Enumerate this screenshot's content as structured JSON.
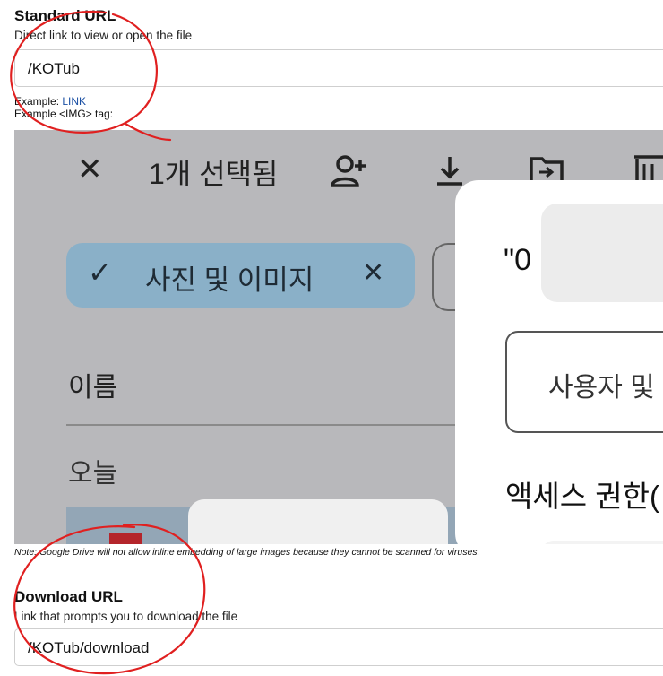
{
  "standard": {
    "title": "Standard URL",
    "description": "Direct link to view or open the file",
    "url_value": "/KOTub",
    "example_label": "Example:",
    "example_link": "LINK",
    "example_img": "Example <IMG> tag:"
  },
  "preview": {
    "toolbar": {
      "close_glyph": "✕",
      "selected_text": "1개 선택됨",
      "icons": [
        "person-add-icon",
        "download-icon",
        "move-to-folder-icon",
        "trash-icon"
      ]
    },
    "chip": {
      "check_glyph": "✓",
      "label": "사진 및 이미지",
      "close_glyph": "✕"
    },
    "list": {
      "column_name": "이름",
      "group_today": "오늘"
    },
    "dialog": {
      "title_partial": "\"0",
      "add_people_partial": "사용자 및",
      "access_partial": "액세스 권한("
    },
    "colors": {
      "overlay": "#b8b8bb",
      "chip": "#8ab0c8",
      "annotation": "#e02020"
    }
  },
  "note": "Note: Google Drive will not allow inline embedding of large images because they cannot be scanned for viruses.",
  "download": {
    "title": "Download URL",
    "description": "Link that prompts you to download the file",
    "url_value": "/KOTub/download"
  }
}
